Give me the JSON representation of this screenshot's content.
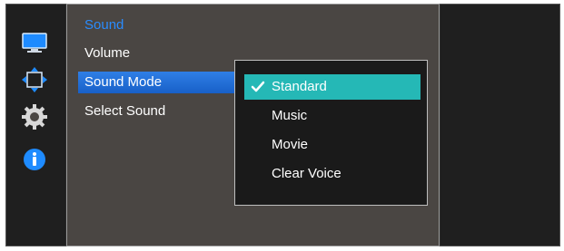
{
  "menu": {
    "title": "Sound",
    "items": [
      {
        "label": "Volume",
        "selected": false
      },
      {
        "label": "Sound Mode",
        "selected": true
      },
      {
        "label": "Select Sound",
        "selected": false
      }
    ]
  },
  "submenu": {
    "options": [
      {
        "label": "Standard",
        "checked": true
      },
      {
        "label": "Music",
        "checked": false
      },
      {
        "label": "Movie",
        "checked": false
      },
      {
        "label": "Clear Voice",
        "checked": false
      }
    ]
  },
  "sidebar_icons": [
    "monitor-icon",
    "resize-arrows-icon",
    "gear-icon",
    "info-icon"
  ],
  "colors": {
    "accent_blue": "#2a8cff",
    "selected_bg": "#1f6fd8",
    "active_option": "#25b8b6",
    "panel_bg": "#4a4643"
  }
}
